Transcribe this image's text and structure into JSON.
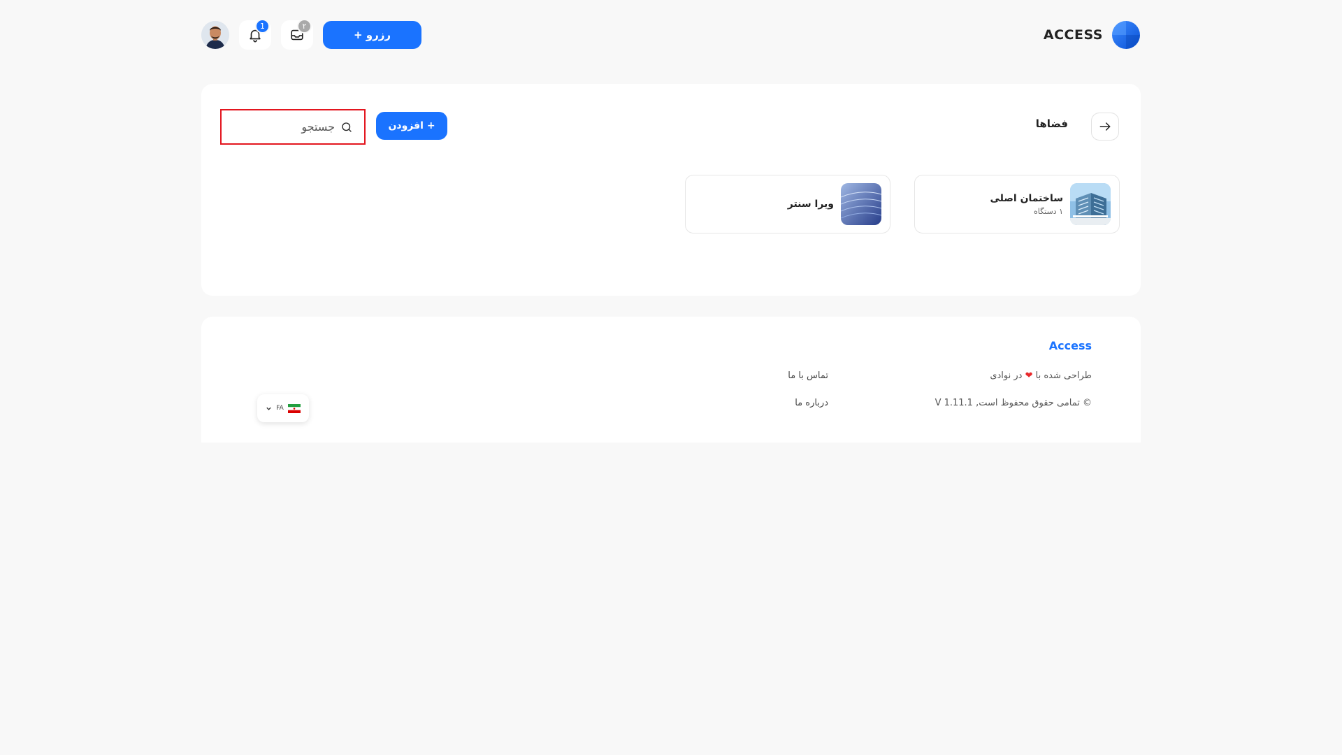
{
  "header": {
    "brand_name": "ACCESS",
    "reserve_button_label": "+ رزرو",
    "inbox_count": "۲",
    "notification_count": "1",
    "colors": {
      "primary": "#1a73ff",
      "inbox_badge": "#a9a9a9",
      "notification_badge": "#1a73ff"
    },
    "icons": [
      "avatar",
      "bell-icon",
      "inbox-icon",
      "plus-icon",
      "brand-logo"
    ]
  },
  "main": {
    "title": "فضاها",
    "add_button_label": "افزودن +",
    "search": {
      "placeholder": "جستجو",
      "value": ""
    },
    "spaces": [
      {
        "name": "ساختمان اصلی",
        "subtitle": "۱ دستگاه"
      },
      {
        "name": "ویرا سنتر",
        "subtitle": ""
      }
    ]
  },
  "footer": {
    "brand": "Access",
    "designed_prefix": "طراحی شده با",
    "designed_suffix": "در نوادی",
    "heart": "❤",
    "copyright": "© تمامی حقوق محفوظ است, V 1.11.1",
    "contact_link": "تماس با ما",
    "about_link": "درباره ما",
    "language_code": "FA"
  }
}
